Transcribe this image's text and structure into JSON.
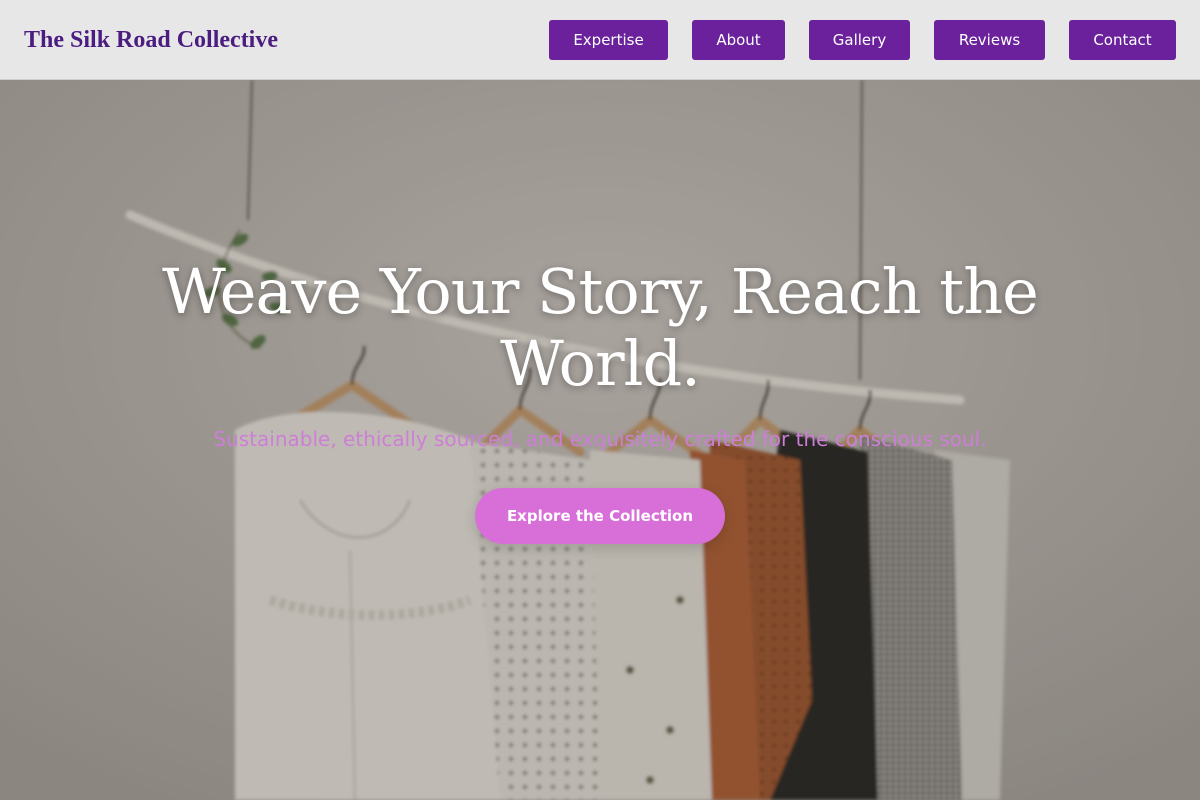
{
  "brand": {
    "name": "The Silk Road Collective"
  },
  "nav": {
    "items": [
      {
        "label": "Expertise"
      },
      {
        "label": "About"
      },
      {
        "label": "Gallery"
      },
      {
        "label": "Reviews"
      },
      {
        "label": "Contact"
      }
    ]
  },
  "hero": {
    "headline": "Weave Your Story, Reach the World.",
    "subtitle": "Sustainable, ethically sourced, and exquisitely crafted for the conscious soul.",
    "cta_label": "Explore the Collection",
    "image": {
      "subject": "clothing-rack-photo"
    }
  },
  "colors": {
    "brand_text": "#4b1d80",
    "nav_button": "#6a219b",
    "accent": "#d86fd8",
    "subtitle": "#cd7ed6",
    "header_bg": "#e8e7e7"
  }
}
